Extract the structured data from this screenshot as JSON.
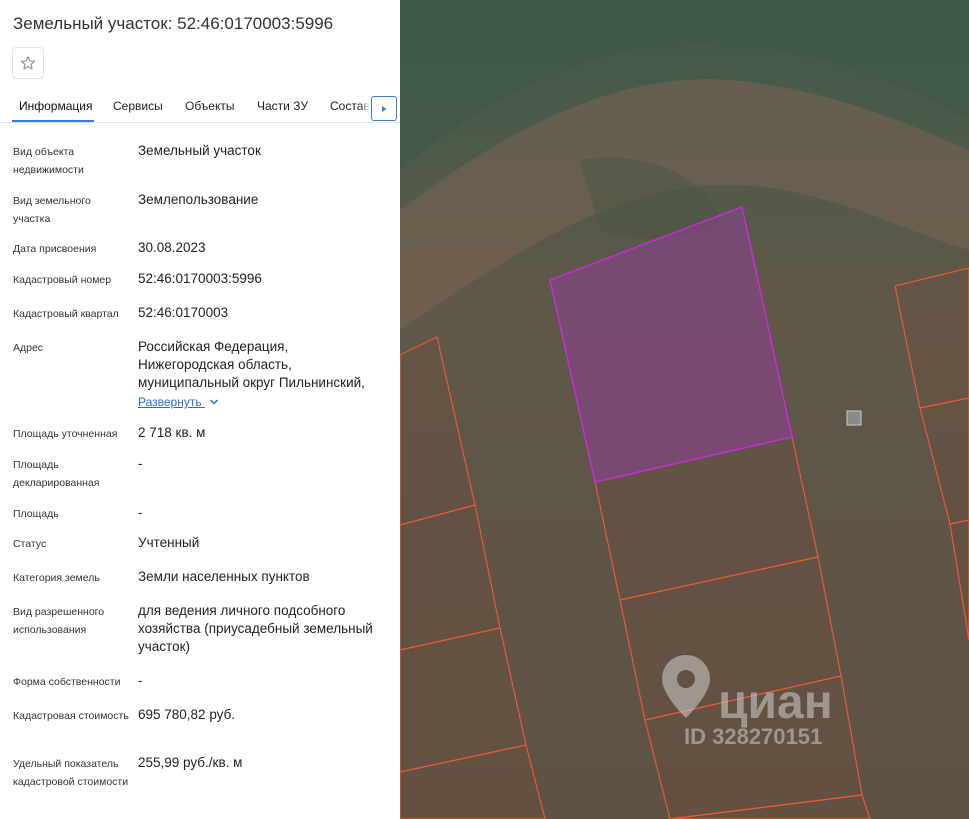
{
  "panel": {
    "title": "Земельный участок: 52:46:0170003:5996",
    "favorite_icon": "star-outline-icon",
    "tabs": [
      {
        "label": "Информация",
        "active": true
      },
      {
        "label": "Сервисы"
      },
      {
        "label": "Объекты"
      },
      {
        "label": "Части ЗУ"
      },
      {
        "label": "Состав"
      }
    ],
    "tabs_next_icon": "triangle-right-icon",
    "fields": [
      {
        "label": "Вид объекта недвижимости",
        "value": "Земельный участок"
      },
      {
        "label": "Вид земельного участка",
        "value": "Землепользование"
      },
      {
        "label": "Дата присвоения",
        "value": "30.08.2023"
      },
      {
        "label": "Кадастровый номер",
        "value": "52:46:0170003:5996"
      },
      {
        "label": "Кадастровый квартал",
        "value": "52:46:0170003"
      },
      {
        "label": "Адрес",
        "value": "Российская Федерация, Нижегородская область, муниципальный округ Пильнинский,"
      },
      {
        "label": "Площадь уточненная",
        "value": "2 718 кв. м"
      },
      {
        "label": "Площадь декларированная",
        "value": "-"
      },
      {
        "label": "Площадь",
        "value": "-"
      },
      {
        "label": "Статус",
        "value": "Учтенный"
      },
      {
        "label": "Категория земель",
        "value": "Земли населенных пунктов"
      },
      {
        "label": "Вид разрешенного использования",
        "value": "для ведения личного подсобного хозяйства (приусадебный земельный участок)"
      },
      {
        "label": "Форма собственности",
        "value": "-"
      },
      {
        "label": "Кадастровая стоимость",
        "value": "695 780,82 руб."
      },
      {
        "label": "Удельный показатель кадастровой стоимости",
        "value": "255,99 руб./кв. м"
      }
    ],
    "expand_label": "Развернуть",
    "expand_icon": "chevron-down-icon"
  },
  "map": {
    "watermark_brand": "циан",
    "watermark_id": "ID 328270151",
    "watermark_icon": "location-pin-icon",
    "selected_color": "#b32ab8",
    "parcel_border_color": "#e8593a"
  }
}
